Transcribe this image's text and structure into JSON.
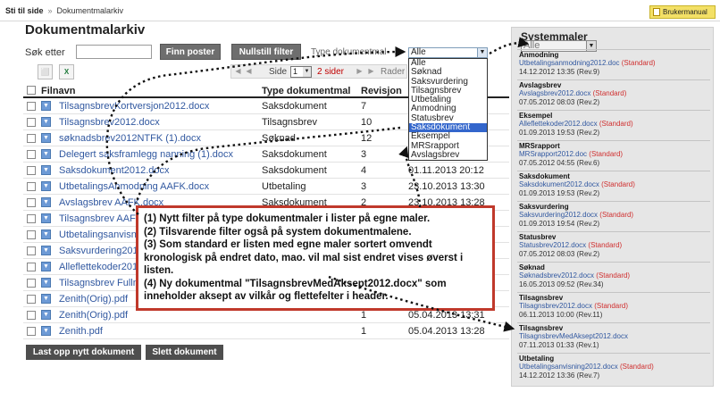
{
  "breadcrumb": {
    "home": "Sti til side",
    "separator": "»",
    "current": "Dokumentmalarkiv"
  },
  "manual_button": "Brukermanual",
  "page_title": "Dokumentmalarkiv",
  "filters": {
    "search_label": "Søk etter",
    "search_value": "",
    "find_button": "Finn poster",
    "reset_button": "Nullstill filter",
    "type_label": "Type dokumentmal",
    "type_selected": "Alle",
    "type_options": [
      "Alle",
      "Søknad",
      "Saksvurdering",
      "Tilsagnsbrev",
      "Utbetaling",
      "Anmodning",
      "Statusbrev",
      "Saksdokument",
      "Eksempel",
      "MRSrapport",
      "Avslagsbrev"
    ],
    "type_highlighted": "Saksdokument"
  },
  "toolbar": {
    "pdf_icon": "pdf-icon",
    "excel_icon": "excel-icon"
  },
  "pager": {
    "page_label": "Side",
    "page_value": "1",
    "page_count": "2 sider",
    "rows_label": "Rader"
  },
  "table": {
    "headers": {
      "filename": "Filnavn",
      "type": "Type dokumentmal",
      "revision": "Revisjon"
    },
    "rows": [
      {
        "file": "TilsagnsbrevKortversjon2012.docx",
        "type": "Saksdokument",
        "rev": "7",
        "date": ""
      },
      {
        "file": "Tilsagnsbrev2012.docx",
        "type": "Tilsagnsbrev",
        "rev": "10",
        "date": ""
      },
      {
        "file": "søknadsbrev2012NTFK (1).docx",
        "type": "Søknad",
        "rev": "12",
        "date": ""
      },
      {
        "file": "Delegert saksframlegg nanning (1).docx",
        "type": "Saksdokument",
        "rev": "3",
        "date": ""
      },
      {
        "file": "Saksdokument2012.docx",
        "type": "Saksdokument",
        "rev": "4",
        "date": "01.11.2013 20:12"
      },
      {
        "file": "UtbetalingsAnmodning AAFK.docx",
        "type": "Utbetaling",
        "rev": "3",
        "date": "23.10.2013 13:30"
      },
      {
        "file": "Avslagsbrev AAFK.docx",
        "type": "Saksdokument",
        "rev": "2",
        "date": "23.10.2013 13:28"
      },
      {
        "file": "Tilsagnsbrev AAFK",
        "type": "",
        "rev": "",
        "date": ""
      },
      {
        "file": "Utbetalingsanvisn",
        "type": "",
        "rev": "",
        "date": ""
      },
      {
        "file": "Saksvurdering201",
        "type": "",
        "rev": "",
        "date": ""
      },
      {
        "file": "Alleflettekoder201",
        "type": "",
        "rev": "",
        "date": ""
      },
      {
        "file": "Tilsagnsbrev Fullm",
        "type": "",
        "rev": "",
        "date": ""
      },
      {
        "file": "Zenith(Orig).pdf",
        "type": "",
        "rev": "",
        "date": ""
      },
      {
        "file": "Zenith(Orig).pdf",
        "type": "",
        "rev": "1",
        "date": "05.04.2013 13:31"
      },
      {
        "file": "Zenith.pdf",
        "type": "",
        "rev": "1",
        "date": "05.04.2013 13:28"
      }
    ]
  },
  "buttons": {
    "upload": "Last opp nytt dokument",
    "delete": "Slett dokument"
  },
  "callout": {
    "lines": [
      "(1) Nytt filter på type dokumentmaler i lister på egne maler.",
      "(2) Tilsvarende filter også på system dokumentmalene.",
      "(3) Som standard er listen med egne maler sortert omvendt kronologisk på endret dato, mao. vil mal sist endret vises øverst i listen.",
      "(4) Ny dokumentmal \"TilsagnsbrevMedAksept2012.docx\" som inneholder aksept av vilkår og flettefelter i header."
    ]
  },
  "system_templates": {
    "title": "Systemmaler",
    "filter_value": "Alle",
    "groups": [
      {
        "type": "Anmodning",
        "file": "Utbetalingsanmodning2012.doc",
        "standard": "(Standard)",
        "date": "14.12.2012 13:35 (Rev.9)"
      },
      {
        "type": "Avslagsbrev",
        "file": "Avslagsbrev2012.docx",
        "standard": "(Standard)",
        "date": "07.05.2012 08:03 (Rev.2)"
      },
      {
        "type": "Eksempel",
        "file": "Alleflettekoder2012.docx",
        "standard": "(Standard)",
        "date": "01.09.2013 19:53 (Rev.2)"
      },
      {
        "type": "MRSrapport",
        "file": "MRSrapport2012.doc",
        "standard": "(Standard)",
        "date": "07.05.2012 04:55 (Rev.6)"
      },
      {
        "type": "Saksdokument",
        "file": "Saksdokument2012.docx",
        "standard": "(Standard)",
        "date": "01.09.2013 19:53 (Rev.2)"
      },
      {
        "type": "Saksvurdering",
        "file": "Saksvurdering2012.docx",
        "standard": "(Standard)",
        "date": "01.09.2013 19:54 (Rev.2)"
      },
      {
        "type": "Statusbrev",
        "file": "Statusbrev2012.docx",
        "standard": "(Standard)",
        "date": "07.05.2012 08:03 (Rev.2)"
      },
      {
        "type": "Søknad",
        "file": "Søknadsbrev2012.docx",
        "standard": "(Standard)",
        "date": "16.05.2013 09:52 (Rev.34)"
      },
      {
        "type": "Tilsagnsbrev",
        "file": "Tilsagnsbrev2012.docx",
        "standard": "(Standard)",
        "date": "06.11.2013 10:00 (Rev.11)"
      },
      {
        "type": "Tilsagnsbrev",
        "file": "TilsagnsbrevMedAksept2012.docx",
        "standard": "",
        "date": "07.11.2013 01:33 (Rev.1)"
      },
      {
        "type": "Utbetaling",
        "file": "Utbetalingsanvisning2012.docx",
        "standard": "(Standard)",
        "date": "14.12.2012 13:36 (Rev.7)"
      }
    ]
  },
  "colors": {
    "accent_red": "#c0392b",
    "link_blue": "#3158a0",
    "standard_red": "#d03030",
    "manual_yellow": "#f3e066",
    "selection_blue": "#3366cc"
  }
}
